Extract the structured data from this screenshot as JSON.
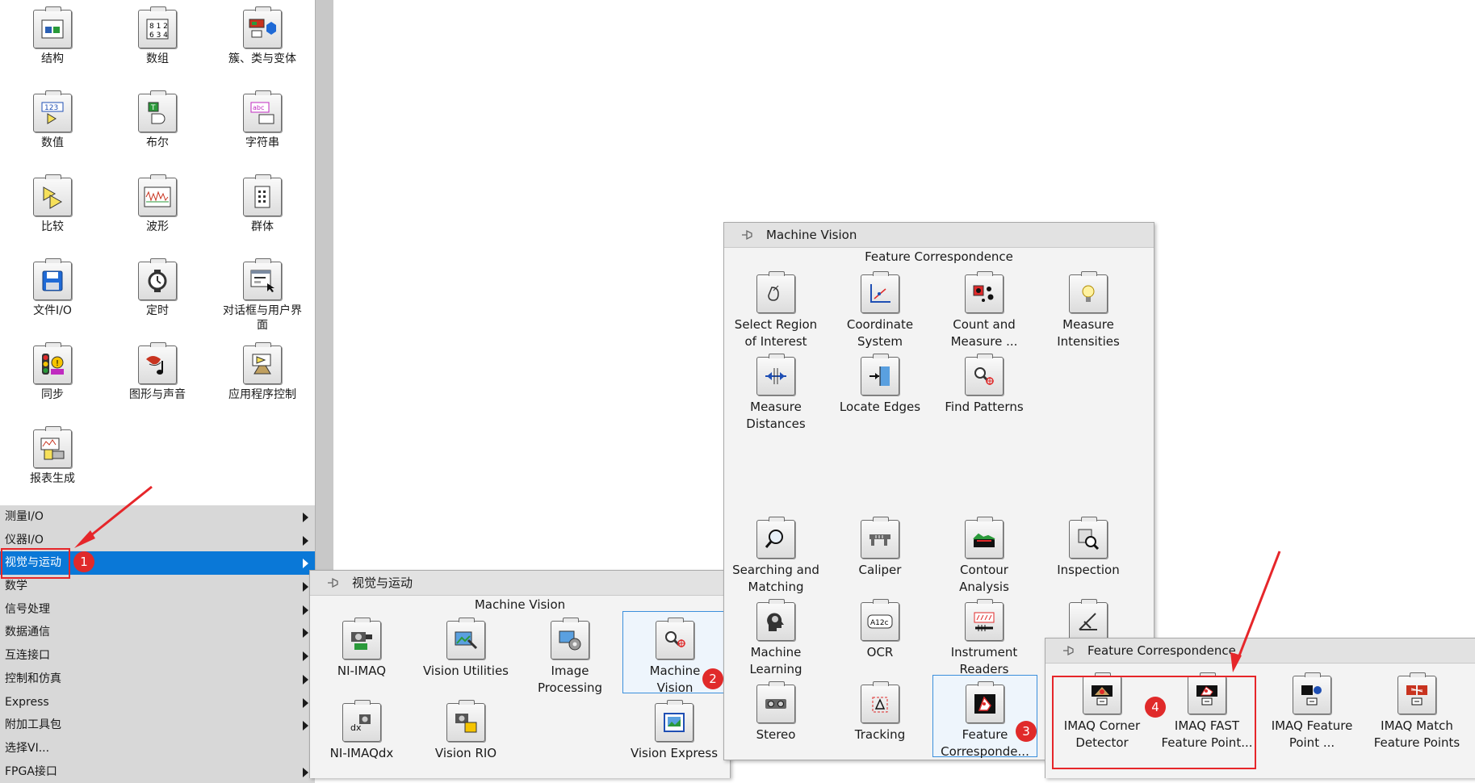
{
  "left_palette": {
    "items": [
      {
        "label": "结构",
        "icon": "structure-icon"
      },
      {
        "label": "数组",
        "icon": "array-icon"
      },
      {
        "label": "簇、类与变体",
        "icon": "cluster-icon"
      },
      {
        "label": "数值",
        "icon": "numeric-icon"
      },
      {
        "label": "布尔",
        "icon": "boolean-icon"
      },
      {
        "label": "字符串",
        "icon": "string-icon"
      },
      {
        "label": "比较",
        "icon": "comparison-icon"
      },
      {
        "label": "波形",
        "icon": "waveform-icon"
      },
      {
        "label": "群体",
        "icon": "cluster-group-icon"
      },
      {
        "label": "文件I/O",
        "icon": "file-io-icon"
      },
      {
        "label": "定时",
        "icon": "timing-icon"
      },
      {
        "label": "对话框与用户界面",
        "icon": "dialog-icon"
      },
      {
        "label": "同步",
        "icon": "sync-icon"
      },
      {
        "label": "图形与声音",
        "icon": "graphics-sound-icon"
      },
      {
        "label": "应用程序控制",
        "icon": "app-control-icon"
      },
      {
        "label": "报表生成",
        "icon": "report-icon"
      }
    ],
    "categories": [
      {
        "label": "测量I/O",
        "selected": false
      },
      {
        "label": "仪器I/O",
        "selected": false
      },
      {
        "label": "视觉与运动",
        "selected": true
      },
      {
        "label": "数学",
        "selected": false
      },
      {
        "label": "信号处理",
        "selected": false
      },
      {
        "label": "数据通信",
        "selected": false
      },
      {
        "label": "互连接口",
        "selected": false
      },
      {
        "label": "控制和仿真",
        "selected": false
      },
      {
        "label": "Express",
        "selected": false
      },
      {
        "label": "附加工具包",
        "selected": false
      },
      {
        "label": "选择VI...",
        "selected": false
      },
      {
        "label": "FPGA接口",
        "selected": false
      }
    ]
  },
  "popup_vision_motion": {
    "title": "视觉与运动",
    "subtitle": "Machine Vision",
    "items": [
      {
        "label": "NI-IMAQ"
      },
      {
        "label": "Vision Utilities"
      },
      {
        "label": "Image\nProcessing"
      },
      {
        "label": "Machine\nVision"
      },
      {
        "label": "NI-IMAQdx"
      },
      {
        "label": "Vision RIO"
      },
      {
        "label": "Vision Express"
      }
    ]
  },
  "popup_machine_vision": {
    "title": "Machine Vision",
    "subtitle": "Feature Correspondence",
    "items": [
      {
        "label": "Select Region\nof Interest"
      },
      {
        "label": "Coordinate\nSystem"
      },
      {
        "label": "Count and\nMeasure ..."
      },
      {
        "label": "Measure\nIntensities"
      },
      {
        "label": "Measure\nDistances"
      },
      {
        "label": "Locate Edges"
      },
      {
        "label": "Find Patterns"
      },
      {
        "label": "Searching and\nMatching"
      },
      {
        "label": "Caliper"
      },
      {
        "label": "Contour\nAnalysis"
      },
      {
        "label": "Inspection"
      },
      {
        "label": "Machine\nLearning"
      },
      {
        "label": "OCR"
      },
      {
        "label": "Instrument\nReaders"
      },
      {
        "label": "Stereo"
      },
      {
        "label": "Tracking"
      },
      {
        "label": "Feature\nCorresponde..."
      }
    ]
  },
  "popup_feature": {
    "title": "Feature Correspondence",
    "items": [
      {
        "label": "IMAQ Corner\nDetector"
      },
      {
        "label": "IMAQ FAST\nFeature Point..."
      },
      {
        "label": "IMAQ Feature\nPoint ..."
      },
      {
        "label": "IMAQ Match\nFeature Points"
      }
    ]
  },
  "badges": [
    "1",
    "2",
    "3",
    "4"
  ],
  "ocr_icon_text": "A12c",
  "colors": {
    "selected": "#0a78d7",
    "annotation": "#e6262a",
    "highlight": "#3b8fdc"
  }
}
